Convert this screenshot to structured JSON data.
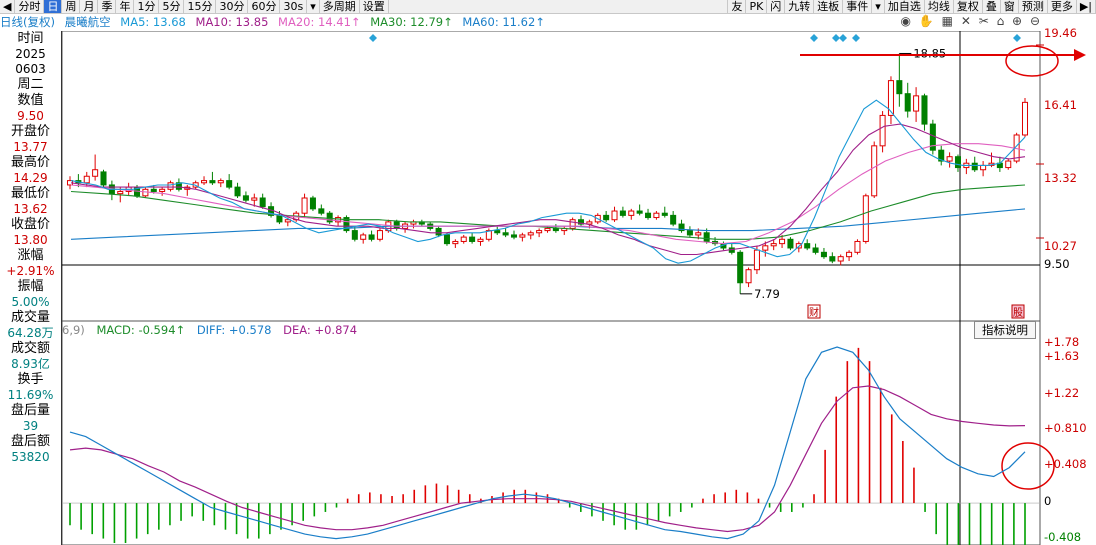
{
  "toolbar": {
    "items": [
      "◀",
      "分时",
      "日",
      "周",
      "月",
      "季",
      "年",
      "1分",
      "5分",
      "15分",
      "30分",
      "60分",
      "30s",
      "▾",
      "多周期",
      "设置"
    ],
    "right_items": [
      "友",
      "PK",
      "闪",
      "九转",
      "连板",
      "事件",
      "▾",
      "加自选",
      "均线",
      "复权",
      "叠",
      "窗",
      "预测",
      "更多",
      "▶|"
    ]
  },
  "ma_bar": {
    "title": "日线(复权)",
    "stock": "晨曦航空",
    "ma5": "MA5: 13.68",
    "ma10": "MA10: 13.85",
    "ma20": "MA20: 14.41↑",
    "ma30": "MA30: 12.79↑",
    "ma60": "MA60: 11.62↑",
    "colors": {
      "ma5": "#1a9ad6",
      "ma10": "#a0208a",
      "ma20": "#e060c0",
      "ma30": "#1d8c2a",
      "ma60": "#1a7ec8"
    }
  },
  "left_panel": [
    {
      "label": "时间"
    },
    {
      "value": "2025",
      "tone": "b"
    },
    {
      "value": "0603",
      "tone": "b"
    },
    {
      "label": "周二"
    },
    {
      "label": "数值"
    },
    {
      "value": "9.50"
    },
    {
      "label": "开盘价"
    },
    {
      "value": "13.77"
    },
    {
      "label": "最高价"
    },
    {
      "value": "14.29"
    },
    {
      "label": "最低价"
    },
    {
      "value": "13.62"
    },
    {
      "label": "收盘价"
    },
    {
      "value": "13.80"
    },
    {
      "label": "涨幅"
    },
    {
      "value": "+2.91%"
    },
    {
      "label": "振幅"
    },
    {
      "value": "5.00%",
      "tone": "g"
    },
    {
      "label": "成交量"
    },
    {
      "value": "64.28万",
      "tone": "g"
    },
    {
      "label": "成交额"
    },
    {
      "value": "8.93亿",
      "tone": "g"
    },
    {
      "label": "换手"
    },
    {
      "value": "11.69%",
      "tone": "g"
    },
    {
      "label": "盘后量"
    },
    {
      "value": "39",
      "tone": "g"
    },
    {
      "label": "盘后额"
    },
    {
      "value": "53820",
      "tone": "g"
    }
  ],
  "price_axis": [
    "19.46",
    "16.41",
    "13.32",
    "10.27",
    "9.50"
  ],
  "macd_axis": [
    "+1.78",
    "+1.63",
    "+1.22",
    "+0.810",
    "+0.408",
    "0",
    "-0.408"
  ],
  "macd_bar": {
    "prefix": "6,9)",
    "macd": "MACD: -0.594↑",
    "diff": "DIFF: +0.578",
    "dea": "DEA: +0.874"
  },
  "annotations": {
    "high_label": "18.85",
    "low_label": "7.79",
    "tip_box": "指标说明",
    "badge_cai": "财",
    "badge_right": "股"
  },
  "chart_data": [
    {
      "type": "candlestick",
      "price_range": [
        7.0,
        19.7
      ],
      "candles_ohlc": [
        [
          12.8,
          13.2,
          12.6,
          13.0
        ],
        [
          13.0,
          13.3,
          12.7,
          12.9
        ],
        [
          12.9,
          13.4,
          12.7,
          13.2
        ],
        [
          13.2,
          14.2,
          13.0,
          13.5
        ],
        [
          13.4,
          13.5,
          12.7,
          12.8
        ],
        [
          12.8,
          13.0,
          12.1,
          12.4
        ],
        [
          12.4,
          12.7,
          12.0,
          12.5
        ],
        [
          12.5,
          12.9,
          12.3,
          12.7
        ],
        [
          12.7,
          12.8,
          12.2,
          12.3
        ],
        [
          12.3,
          12.7,
          12.2,
          12.6
        ],
        [
          12.6,
          12.8,
          12.4,
          12.5
        ],
        [
          12.5,
          12.7,
          12.3,
          12.6
        ],
        [
          12.6,
          13.0,
          12.5,
          12.9
        ],
        [
          12.9,
          13.1,
          12.5,
          12.6
        ],
        [
          12.6,
          12.8,
          12.3,
          12.7
        ],
        [
          12.7,
          13.0,
          12.6,
          12.9
        ],
        [
          12.9,
          13.2,
          12.8,
          13.0
        ],
        [
          13.0,
          13.4,
          12.8,
          12.9
        ],
        [
          12.9,
          13.1,
          12.7,
          13.0
        ],
        [
          13.0,
          13.3,
          12.6,
          12.7
        ],
        [
          12.7,
          12.9,
          12.2,
          12.3
        ],
        [
          12.3,
          12.5,
          12.0,
          12.1
        ],
        [
          12.1,
          12.4,
          11.8,
          12.2
        ],
        [
          12.2,
          12.4,
          11.7,
          11.8
        ],
        [
          11.8,
          12.0,
          11.3,
          11.4
        ],
        [
          11.4,
          11.6,
          11.0,
          11.1
        ],
        [
          11.1,
          11.3,
          10.9,
          11.2
        ],
        [
          11.2,
          11.6,
          11.1,
          11.5
        ],
        [
          11.5,
          12.4,
          11.3,
          12.2
        ],
        [
          12.2,
          12.3,
          11.6,
          11.7
        ],
        [
          11.7,
          11.9,
          11.4,
          11.5
        ],
        [
          11.5,
          11.6,
          11.0,
          11.1
        ],
        [
          11.1,
          11.4,
          10.9,
          11.3
        ],
        [
          11.3,
          11.4,
          10.6,
          10.7
        ],
        [
          10.7,
          10.9,
          10.2,
          10.3
        ],
        [
          10.3,
          10.6,
          10.1,
          10.5
        ],
        [
          10.5,
          10.7,
          10.2,
          10.3
        ],
        [
          10.3,
          10.8,
          10.2,
          10.7
        ],
        [
          10.7,
          11.2,
          10.6,
          11.1
        ],
        [
          11.1,
          11.2,
          10.7,
          10.8
        ],
        [
          10.8,
          11.1,
          10.6,
          11.0
        ],
        [
          11.0,
          11.2,
          10.8,
          11.1
        ],
        [
          11.1,
          11.2,
          10.9,
          11.0
        ],
        [
          11.0,
          11.1,
          10.7,
          10.8
        ],
        [
          10.8,
          10.9,
          10.4,
          10.5
        ],
        [
          10.5,
          10.6,
          10.0,
          10.1
        ],
        [
          10.1,
          10.3,
          9.9,
          10.2
        ],
        [
          10.2,
          10.5,
          10.1,
          10.4
        ],
        [
          10.4,
          10.6,
          10.1,
          10.2
        ],
        [
          10.2,
          10.4,
          10.0,
          10.3
        ],
        [
          10.3,
          10.8,
          10.2,
          10.7
        ],
        [
          10.7,
          10.9,
          10.5,
          10.6
        ],
        [
          10.6,
          10.8,
          10.4,
          10.5
        ],
        [
          10.5,
          10.7,
          10.3,
          10.4
        ],
        [
          10.4,
          10.6,
          10.2,
          10.5
        ],
        [
          10.5,
          10.7,
          10.3,
          10.6
        ],
        [
          10.6,
          10.8,
          10.4,
          10.7
        ],
        [
          10.7,
          10.9,
          10.6,
          10.8
        ],
        [
          10.8,
          11.0,
          10.6,
          10.7
        ],
        [
          10.7,
          10.9,
          10.5,
          10.8
        ],
        [
          10.8,
          11.3,
          10.7,
          11.2
        ],
        [
          11.2,
          11.4,
          10.9,
          11.0
        ],
        [
          11.0,
          11.2,
          10.8,
          11.1
        ],
        [
          11.1,
          11.5,
          11.0,
          11.4
        ],
        [
          11.4,
          11.6,
          11.1,
          11.2
        ],
        [
          11.2,
          11.8,
          11.1,
          11.6
        ],
        [
          11.6,
          11.8,
          11.3,
          11.4
        ],
        [
          11.4,
          11.7,
          11.2,
          11.6
        ],
        [
          11.6,
          11.9,
          11.4,
          11.5
        ],
        [
          11.5,
          11.7,
          11.2,
          11.3
        ],
        [
          11.3,
          11.6,
          11.2,
          11.5
        ],
        [
          11.5,
          11.8,
          11.3,
          11.4
        ],
        [
          11.4,
          11.6,
          10.9,
          11.0
        ],
        [
          11.0,
          11.2,
          10.6,
          10.7
        ],
        [
          10.7,
          10.9,
          10.4,
          10.5
        ],
        [
          10.5,
          10.8,
          10.3,
          10.6
        ],
        [
          10.6,
          10.8,
          10.1,
          10.2
        ],
        [
          10.2,
          10.4,
          10.0,
          10.1
        ],
        [
          10.1,
          10.2,
          9.8,
          9.9
        ],
        [
          9.9,
          10.1,
          9.6,
          9.7
        ],
        [
          9.7,
          9.8,
          7.79,
          8.3
        ],
        [
          8.3,
          9.0,
          8.1,
          8.9
        ],
        [
          8.9,
          10.0,
          8.7,
          9.8
        ],
        [
          9.8,
          10.2,
          9.5,
          10.0
        ],
        [
          10.0,
          10.3,
          9.8,
          10.1
        ],
        [
          10.1,
          10.5,
          9.9,
          10.3
        ],
        [
          10.3,
          10.4,
          9.8,
          9.9
        ],
        [
          9.9,
          10.2,
          9.7,
          10.1
        ],
        [
          10.1,
          10.3,
          9.8,
          9.9
        ],
        [
          9.9,
          10.1,
          9.6,
          9.7
        ],
        [
          9.7,
          9.9,
          9.4,
          9.5
        ],
        [
          9.5,
          9.7,
          9.2,
          9.3
        ],
        [
          9.3,
          9.6,
          9.1,
          9.5
        ],
        [
          9.5,
          9.8,
          9.3,
          9.7
        ],
        [
          9.7,
          10.3,
          9.6,
          10.2
        ],
        [
          10.2,
          12.4,
          10.1,
          12.3
        ],
        [
          12.3,
          14.8,
          12.2,
          14.6
        ],
        [
          14.6,
          16.2,
          14.3,
          16.0
        ],
        [
          16.0,
          17.8,
          15.6,
          17.6
        ],
        [
          17.6,
          18.85,
          16.4,
          17.0
        ],
        [
          17.0,
          17.5,
          15.9,
          16.2
        ],
        [
          16.2,
          17.3,
          15.7,
          16.9
        ],
        [
          16.9,
          17.0,
          15.3,
          15.6
        ],
        [
          15.6,
          15.8,
          14.2,
          14.4
        ],
        [
          14.4,
          14.6,
          13.7,
          13.9
        ],
        [
          13.9,
          14.3,
          13.6,
          14.1
        ],
        [
          14.1,
          14.2,
          13.4,
          13.6
        ],
        [
          13.6,
          14.0,
          13.3,
          13.8
        ],
        [
          13.8,
          14.1,
          13.4,
          13.5
        ],
        [
          13.5,
          13.9,
          13.2,
          13.7
        ],
        [
          13.7,
          14.29,
          13.62,
          13.8
        ],
        [
          13.8,
          14.1,
          13.4,
          13.6
        ],
        [
          13.6,
          14.0,
          13.5,
          13.9
        ],
        [
          13.9,
          15.2,
          13.8,
          15.1
        ],
        [
          15.1,
          16.8,
          15.0,
          16.6
        ]
      ],
      "ma5": [
        13.0,
        12.9,
        12.8,
        12.6,
        12.6,
        12.6,
        12.7,
        12.8,
        12.8,
        12.9,
        12.8,
        12.5,
        12.2,
        12.0,
        11.7,
        11.6,
        11.5,
        11.4,
        11.1,
        10.8,
        10.6,
        10.7,
        10.8,
        10.9,
        11.0,
        10.9,
        10.6,
        10.4,
        10.2,
        10.3,
        10.5,
        10.6,
        10.6,
        10.6,
        10.7,
        10.8,
        11.0,
        11.1,
        11.3,
        11.4,
        11.5,
        11.5,
        11.4,
        11.1,
        10.8,
        10.5,
        10.2,
        9.9,
        9.4,
        9.2,
        9.3,
        9.6,
        9.9,
        10.1,
        10.1,
        9.9,
        9.7,
        9.5,
        9.6,
        10.1,
        11.3,
        12.7,
        14.1,
        15.2,
        16.3,
        16.7,
        16.3,
        15.6,
        14.9,
        14.3,
        14.0,
        13.8,
        13.7,
        13.7,
        13.7,
        13.8,
        14.4,
        15.0
      ],
      "ma10": [
        12.9,
        12.8,
        12.7,
        12.7,
        12.7,
        12.7,
        12.7,
        12.7,
        12.6,
        12.4,
        12.2,
        12.0,
        11.8,
        11.6,
        11.3,
        11.1,
        11.0,
        10.9,
        10.9,
        10.9,
        10.8,
        10.8,
        10.7,
        10.6,
        10.6,
        10.7,
        10.8,
        10.9,
        11.0,
        11.1,
        11.2,
        11.2,
        11.1,
        11.0,
        10.8,
        10.5,
        10.3,
        10.0,
        9.8,
        9.6,
        9.6,
        9.7,
        9.8,
        9.9,
        10.0,
        10.3,
        10.9,
        11.7,
        12.6,
        13.4,
        14.4,
        15.1,
        15.5,
        15.6,
        15.4,
        15.1,
        14.8,
        14.5,
        14.3,
        14.1,
        14.0,
        14.1
      ],
      "ma20": [
        12.8,
        12.7,
        12.6,
        12.5,
        12.4,
        12.2,
        12.0,
        11.8,
        11.6,
        11.4,
        11.3,
        11.2,
        11.1,
        11.0,
        10.9,
        10.9,
        10.9,
        10.9,
        10.9,
        10.9,
        10.9,
        10.9,
        10.9,
        10.8,
        10.7,
        10.5,
        10.3,
        10.2,
        10.1,
        10.2,
        10.6,
        11.1,
        11.8,
        12.6,
        13.3,
        13.9,
        14.3,
        14.6,
        14.7,
        14.7,
        14.6,
        14.4
      ],
      "ma30": [
        12.5,
        12.4,
        12.3,
        12.1,
        11.9,
        11.7,
        11.5,
        11.4,
        11.3,
        11.2,
        11.2,
        11.1,
        11.1,
        11.0,
        10.9,
        10.9,
        10.8,
        10.7,
        10.6,
        10.5,
        10.4,
        10.3,
        10.3,
        10.4,
        10.7,
        11.1,
        11.6,
        12.0,
        12.4,
        12.6,
        12.7,
        12.8
      ],
      "ma60": [
        10.3,
        10.4,
        10.5,
        10.6,
        10.7,
        10.8,
        10.8,
        10.9,
        10.9,
        10.9,
        10.9,
        10.9,
        10.8,
        10.8,
        10.7,
        10.7,
        10.8,
        10.9,
        11.1,
        11.3,
        11.5,
        11.7
      ]
    },
    {
      "type": "macd",
      "y_range": [
        -0.45,
        1.85
      ],
      "histogram": [
        -0.25,
        -0.3,
        -0.35,
        -0.4,
        -0.45,
        -0.45,
        -0.4,
        -0.35,
        -0.3,
        -0.25,
        -0.2,
        -0.15,
        -0.2,
        -0.25,
        -0.3,
        -0.35,
        -0.4,
        -0.4,
        -0.35,
        -0.3,
        -0.25,
        -0.2,
        -0.15,
        -0.1,
        -0.05,
        0.05,
        0.1,
        0.12,
        0.1,
        0.08,
        0.1,
        0.15,
        0.2,
        0.22,
        0.2,
        0.15,
        0.1,
        0.05,
        0.08,
        0.12,
        0.15,
        0.15,
        0.12,
        0.1,
        0.05,
        -0.05,
        -0.1,
        -0.15,
        -0.2,
        -0.25,
        -0.3,
        -0.3,
        -0.25,
        -0.2,
        -0.15,
        -0.1,
        -0.05,
        0.05,
        0.1,
        0.12,
        0.15,
        0.12,
        0.05,
        -0.05,
        -0.1,
        -0.1,
        -0.05,
        0.1,
        0.6,
        1.2,
        1.6,
        1.75,
        1.6,
        1.3,
        1.0,
        0.7,
        0.4,
        -0.1,
        -0.35,
        -0.5,
        -0.55,
        -0.6,
        -0.6,
        -0.55,
        -0.5,
        -0.55,
        -0.59
      ],
      "diff": [
        0.8,
        0.75,
        0.65,
        0.55,
        0.45,
        0.35,
        0.25,
        0.15,
        0.05,
        -0.05,
        -0.1,
        -0.15,
        -0.2,
        -0.25,
        -0.3,
        -0.35,
        -0.38,
        -0.4,
        -0.38,
        -0.35,
        -0.3,
        -0.25,
        -0.2,
        -0.15,
        -0.1,
        -0.05,
        0.0,
        0.05,
        0.08,
        0.1,
        0.08,
        0.05,
        0.0,
        -0.05,
        -0.1,
        -0.15,
        -0.2,
        -0.25,
        -0.3,
        -0.32,
        -0.35,
        -0.38,
        -0.4,
        -0.35,
        -0.2,
        0.2,
        0.8,
        1.4,
        1.7,
        1.76,
        1.7,
        1.5,
        1.2,
        0.95,
        0.8,
        0.65,
        0.5,
        0.4,
        0.33,
        0.3,
        0.4,
        0.578
      ],
      "dea": [
        0.6,
        0.62,
        0.6,
        0.55,
        0.5,
        0.42,
        0.35,
        0.25,
        0.18,
        0.1,
        0.02,
        -0.05,
        -0.1,
        -0.15,
        -0.2,
        -0.25,
        -0.28,
        -0.3,
        -0.3,
        -0.28,
        -0.25,
        -0.2,
        -0.15,
        -0.1,
        -0.05,
        0.0,
        0.02,
        0.04,
        0.05,
        0.05,
        0.05,
        0.04,
        0.02,
        -0.02,
        -0.06,
        -0.1,
        -0.14,
        -0.18,
        -0.22,
        -0.25,
        -0.28,
        -0.3,
        -0.32,
        -0.3,
        -0.25,
        -0.1,
        0.2,
        0.55,
        0.9,
        1.15,
        1.3,
        1.32,
        1.28,
        1.2,
        1.1,
        1.0,
        0.95,
        0.92,
        0.9,
        0.88,
        0.87,
        0.874
      ]
    }
  ]
}
